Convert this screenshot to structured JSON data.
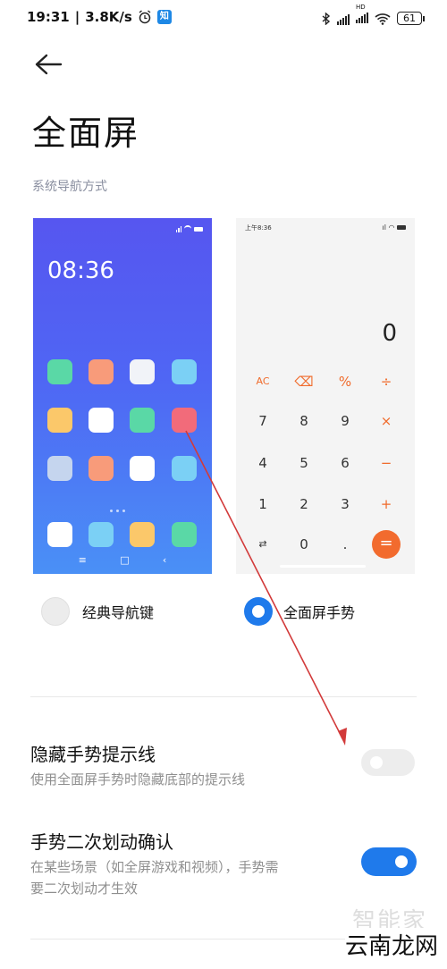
{
  "status": {
    "time": "19:31",
    "speed": "3.8K/s",
    "app_badge": "知",
    "hd": "HD",
    "battery": "61"
  },
  "page": {
    "title": "全面屏",
    "section_label": "系统导航方式"
  },
  "preview_classic": {
    "clock": "08:36",
    "app_colors": [
      "#5ad8a6",
      "#f89b7a",
      "#f1f3f8",
      "#7bd0f5",
      "#fbc86a",
      "#ffffff",
      "#5ad8a6",
      "#f26b7a",
      "#c5d5ee",
      "#f89b7a",
      "#ffffff",
      "#7bd0f5",
      "#ffffff",
      "#7bd0f5",
      "#fbc86a",
      "#5ad8a6"
    ],
    "nav": [
      "≡",
      "□",
      "‹"
    ]
  },
  "preview_gesture": {
    "time": "上午8:36",
    "display": "0",
    "keys": [
      [
        "AC",
        "⌫",
        "%",
        "÷"
      ],
      [
        "7",
        "8",
        "9",
        "×"
      ],
      [
        "4",
        "5",
        "6",
        "−"
      ],
      [
        "1",
        "2",
        "3",
        "+"
      ],
      [
        "⇄",
        "0",
        ".",
        "="
      ]
    ]
  },
  "nav_options": {
    "classic": "经典导航键",
    "gesture": "全面屏手势",
    "selected": "gesture"
  },
  "settings": [
    {
      "title": "隐藏手势提示线",
      "subtitle": "使用全面屏手势时隐藏底部的提示线",
      "enabled": false
    },
    {
      "title": "手势二次划动确认",
      "subtitle_line1": "在某些场景（如全屏游戏和视频），手势需",
      "subtitle_line2": "要二次划动才生效",
      "enabled": true
    }
  ],
  "watermark": {
    "faint": "智能家",
    "text": "云南龙网"
  },
  "colors": {
    "accent": "#1f7aeb",
    "calc_orange": "#f06a2a",
    "arrow": "#d23a3a"
  }
}
